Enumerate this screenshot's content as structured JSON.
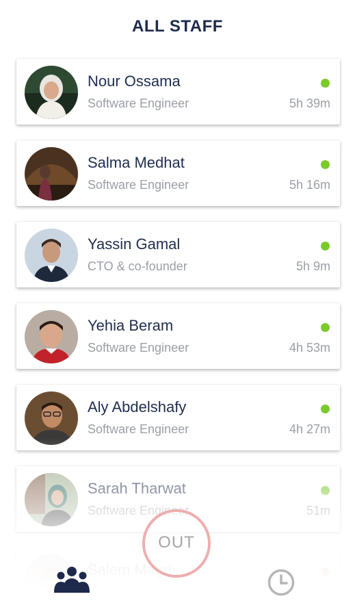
{
  "header": {
    "title": "ALL STAFF"
  },
  "staff": [
    {
      "name": "Nour Ossama",
      "role": "Software Engineer",
      "duration": "5h 39m",
      "status": "online"
    },
    {
      "name": "Salma Medhat",
      "role": "Software Engineer",
      "duration": "5h 16m",
      "status": "online"
    },
    {
      "name": "Yassin Gamal",
      "role": "CTO & co-founder",
      "duration": "5h 9m",
      "status": "online"
    },
    {
      "name": "Yehia Beram",
      "role": "Software Engineer",
      "duration": "4h 53m",
      "status": "online"
    },
    {
      "name": "Aly Abdelshafy",
      "role": "Software Engineer",
      "duration": "4h 27m",
      "status": "online"
    },
    {
      "name": "Sarah Tharwat",
      "role": "Software Engineer",
      "duration": "51m",
      "status": "online"
    },
    {
      "name": "Salem Magdy",
      "role": "",
      "duration": "",
      "status": "away"
    }
  ],
  "actions": {
    "out_label": "OUT"
  },
  "nav": {
    "team_icon": "team-icon",
    "clock_icon": "clock-icon"
  },
  "colors": {
    "online": "#7acb2a",
    "away": "#e24b4b",
    "out_ring": "#eca0a0",
    "title": "#1d2a4b",
    "icon": "#1d2a4b"
  }
}
